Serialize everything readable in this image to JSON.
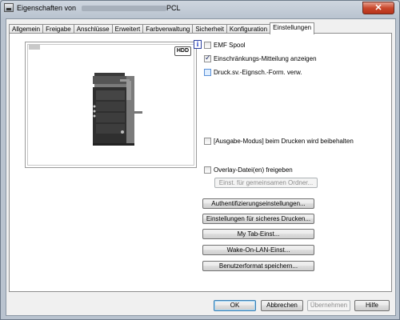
{
  "window": {
    "title_prefix": "Eigenschaften von",
    "title_suffix": "PCL",
    "close_label": "✕"
  },
  "tabs": [
    {
      "label": "Allgemein"
    },
    {
      "label": "Freigabe"
    },
    {
      "label": "Anschlüsse"
    },
    {
      "label": "Erweitert"
    },
    {
      "label": "Farbverwaltung"
    },
    {
      "label": "Sicherheit"
    },
    {
      "label": "Konfiguration"
    },
    {
      "label": "Einstellungen",
      "active": true
    }
  ],
  "preview": {
    "hdd_label": "HDD"
  },
  "options": {
    "emf_spool": {
      "label": "EMF Spool",
      "checked": false
    },
    "restriction_notice": {
      "label": "Einschränkungs-Mitteilung anzeigen",
      "checked": true
    },
    "print_default": {
      "label": "Druck.sv.-Eignsch.-Form. verw.",
      "checked": false
    },
    "output_mode": {
      "label": "[Ausgabe-Modus] beim Drucken wird beibehalten",
      "checked": false
    },
    "overlay_share": {
      "label": "Overlay-Datei(en) freigeben",
      "checked": false
    }
  },
  "buttons": {
    "shared_folder": "Einst. für gemeinsamen Ordner...",
    "auth_settings": "Authentifizierungseinstellungen...",
    "secure_print": "Einstellungen für sicheres Drucken...",
    "my_tab": "My Tab-Einst...",
    "wake_on_lan": "Wake-On-LAN-Einst...",
    "save_user_format": "Benutzerformat speichern..."
  },
  "footer": {
    "ok": "OK",
    "cancel": "Abbrechen",
    "apply": "Übernehmen",
    "help": "Hilfe"
  }
}
